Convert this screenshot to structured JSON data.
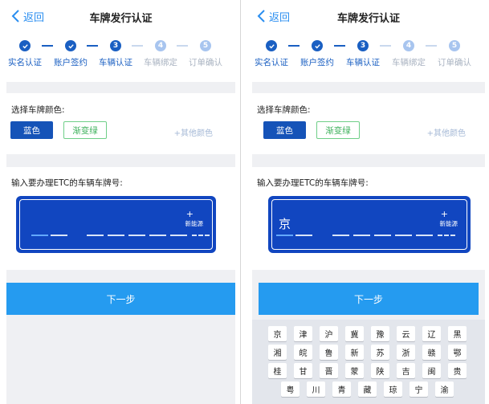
{
  "screens": [
    {
      "nav": {
        "back_label": "返回",
        "title": "车牌发行认证"
      },
      "steps": [
        {
          "label": "实名认证",
          "state": "done",
          "number": ""
        },
        {
          "label": "账户签约",
          "state": "done",
          "number": ""
        },
        {
          "label": "车辆认证",
          "state": "active",
          "number": "3"
        },
        {
          "label": "车辆绑定",
          "state": "todo",
          "number": "4"
        },
        {
          "label": "订单确认",
          "state": "todo",
          "number": "5"
        }
      ],
      "color_section": {
        "label": "选择车牌颜色:",
        "blue_label": "蓝色",
        "gradient_green_label": "渐变绿",
        "other_label": "+其他颜色"
      },
      "plate_section": {
        "label": "输入要办理ETC的车辆车牌号:",
        "first_char": "",
        "new_energy_plus": "+",
        "new_energy_label": "新能源"
      },
      "next_label": "下一步",
      "keyboard_visible": false
    },
    {
      "nav": {
        "back_label": "返回",
        "title": "车牌发行认证"
      },
      "steps": [
        {
          "label": "实名认证",
          "state": "done",
          "number": ""
        },
        {
          "label": "账户签约",
          "state": "done",
          "number": ""
        },
        {
          "label": "车辆认证",
          "state": "active",
          "number": "3"
        },
        {
          "label": "车辆绑定",
          "state": "todo",
          "number": "4"
        },
        {
          "label": "订单确认",
          "state": "todo",
          "number": "5"
        }
      ],
      "color_section": {
        "label": "选择车牌颜色:",
        "blue_label": "蓝色",
        "gradient_green_label": "渐变绿",
        "other_label": "+其他颜色"
      },
      "plate_section": {
        "label": "输入要办理ETC的车辆车牌号:",
        "first_char": "京",
        "new_energy_plus": "+",
        "new_energy_label": "新能源"
      },
      "next_label": "下一步",
      "keyboard_visible": true
    }
  ],
  "keyboard": {
    "rows": [
      [
        "京",
        "津",
        "沪",
        "冀",
        "豫",
        "云",
        "辽",
        "黑"
      ],
      [
        "湘",
        "皖",
        "鲁",
        "新",
        "苏",
        "浙",
        "赣",
        "鄂"
      ],
      [
        "桂",
        "甘",
        "晋",
        "蒙",
        "陕",
        "吉",
        "闽",
        "贵"
      ],
      [
        "粤",
        "川",
        "青",
        "藏",
        "琼",
        "宁",
        "渝"
      ]
    ]
  },
  "colors": {
    "accent": "#259bf0",
    "plate_blue": "#1146c0",
    "step_blue": "#1a5fc2",
    "green": "#3cb05a"
  }
}
